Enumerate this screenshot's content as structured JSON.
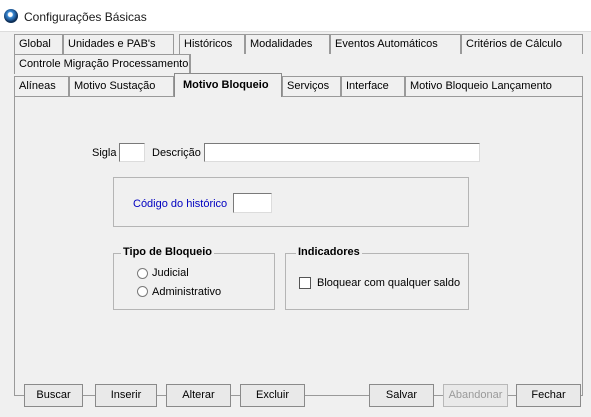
{
  "window": {
    "title": "Configurações Básicas",
    "icon": "app-icon"
  },
  "tabs_row1": [
    "Global",
    "Unidades e PAB's",
    "Históricos",
    "Modalidades",
    "Eventos Automáticos",
    "Critérios de Cálculo"
  ],
  "tabs_row2": [
    "Controle Migração Processamento"
  ],
  "tabs_row3": [
    "Alíneas",
    "Motivo Sustação",
    "Motivo Bloqueio",
    "Serviços",
    "Interface",
    "Motivo Bloqueio Lançamento"
  ],
  "active_tab": "Motivo Bloqueio",
  "form": {
    "sigla_label": "Sigla",
    "sigla_value": "",
    "descricao_label": "Descrição",
    "descricao_value": "",
    "codigo_historico_label": "Código do histórico",
    "codigo_historico_value": "",
    "codigo_historico_color": "#0000c0"
  },
  "tipo_bloqueio": {
    "title": "Tipo de Bloqueio",
    "options": [
      "Judicial",
      "Administrativo"
    ]
  },
  "indicadores": {
    "title": "Indicadores",
    "checkbox_label": "Bloquear com qualquer saldo",
    "checked": false
  },
  "buttons": {
    "buscar": "Buscar",
    "inserir": "Inserir",
    "alterar": "Alterar",
    "excluir": "Excluir",
    "salvar": "Salvar",
    "abandonar": "Abandonar",
    "fechar": "Fechar"
  }
}
